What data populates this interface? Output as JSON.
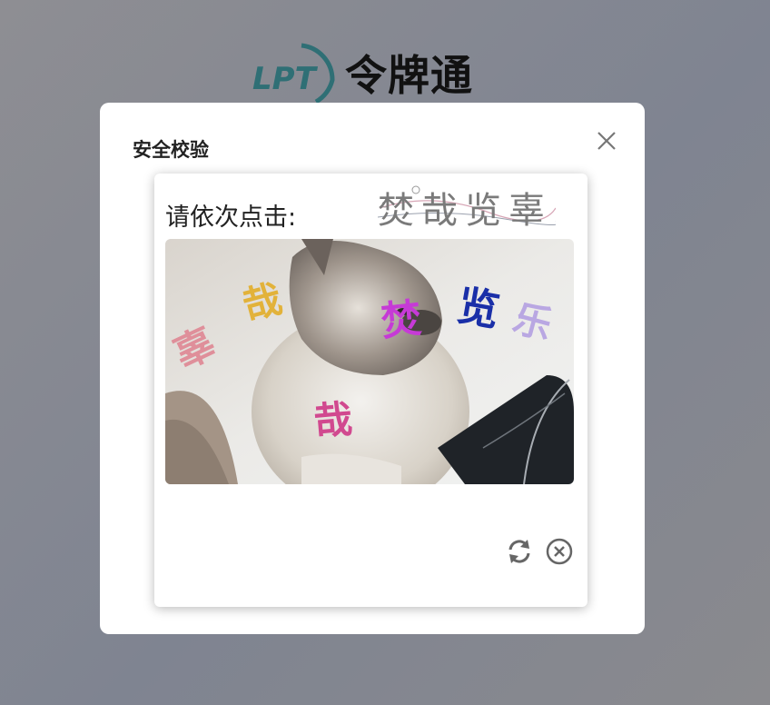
{
  "brand": {
    "logo_text": "LPT",
    "name": "令牌通"
  },
  "dialog": {
    "title": "安全校验"
  },
  "captcha": {
    "prompt": "请依次点击:",
    "target_chars": [
      "焚",
      "哉",
      "览",
      "辜"
    ],
    "image_chars": [
      {
        "char": "焚",
        "color": "#c63ad6"
      },
      {
        "char": "哉",
        "color": "#e2b23a"
      },
      {
        "char": "览",
        "color": "#1a2fa8"
      },
      {
        "char": "辜",
        "color": "#df8f9a"
      },
      {
        "char": "哉",
        "color": "#d1498f"
      },
      {
        "char": "乐",
        "color": "#b9a7e2"
      }
    ]
  },
  "colors": {
    "overlay": "#86898f",
    "dialog_bg": "#ffffff",
    "icon_gray": "#777777"
  }
}
